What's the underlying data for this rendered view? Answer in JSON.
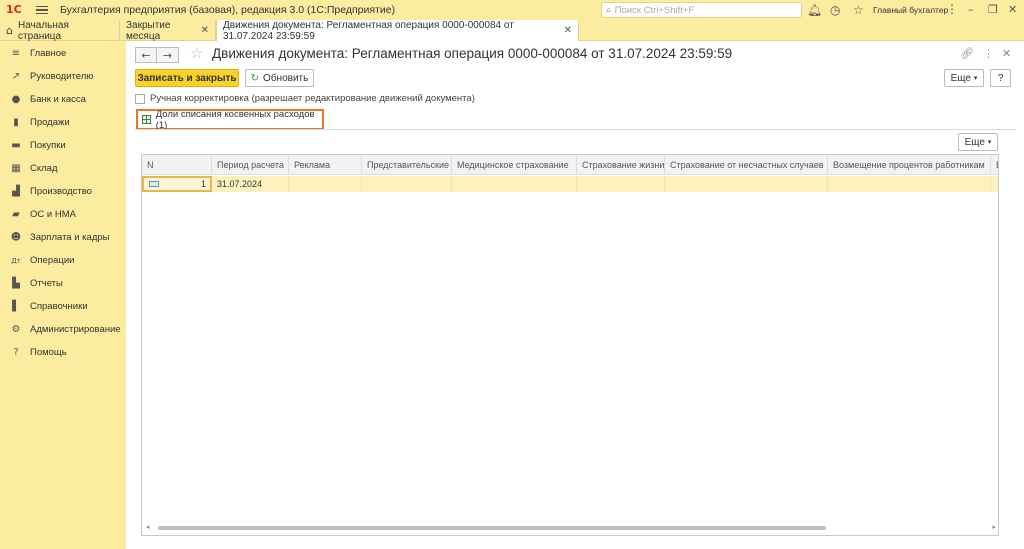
{
  "app": {
    "logo": "1С",
    "title": "Бухгалтерия предприятия (базовая), редакция 3.0  (1С:Предприятие)",
    "search_placeholder": "Поиск Ctrl+Shift+F",
    "user": "Главный бухгалтер",
    "icons": [
      "bell-icon",
      "history-icon",
      "star-icon"
    ]
  },
  "tabs": [
    {
      "label": "Начальная страница"
    },
    {
      "label": "Закрытие месяца"
    },
    {
      "label": "Движения документа: Регламентная операция 0000-000084 от 31.07.2024 23:59:59"
    }
  ],
  "sidebar": {
    "items": [
      {
        "label": "Главное",
        "icon": "menu-icon"
      },
      {
        "label": "Руководителю",
        "icon": "chart-line-icon"
      },
      {
        "label": "Банк и касса",
        "icon": "coins-icon"
      },
      {
        "label": "Продажи",
        "icon": "bag-icon"
      },
      {
        "label": "Покупки",
        "icon": "cart-icon"
      },
      {
        "label": "Склад",
        "icon": "boxes-icon"
      },
      {
        "label": "Производство",
        "icon": "factory-icon"
      },
      {
        "label": "ОС и НМА",
        "icon": "truck-icon"
      },
      {
        "label": "Зарплата и кадры",
        "icon": "person-icon"
      },
      {
        "label": "Операции",
        "icon": "operations-icon"
      },
      {
        "label": "Отчеты",
        "icon": "bar-chart-icon"
      },
      {
        "label": "Справочники",
        "icon": "book-icon"
      },
      {
        "label": "Администрирование",
        "icon": "gear-icon"
      },
      {
        "label": "Помощь",
        "icon": "question-icon"
      }
    ]
  },
  "document": {
    "title": "Движения документа: Регламентная операция 0000-000084 от 31.07.2024 23:59:59",
    "save_close": "Записать и закрыть",
    "refresh": "Обновить",
    "more": "Еще",
    "help": "?",
    "manual_correction": "Ручная корректировка (разрешает редактирование движений документа)",
    "manual_correction_checked": false,
    "table_tab": "Доли списания косвенных расходов (1)"
  },
  "grid": {
    "more": "Еще",
    "columns": [
      "N",
      "Период расчета",
      "Реклама",
      "Представительские",
      "Медицинское страхование",
      "Страхование жизни",
      "Страхование от несчастных случаев",
      "Возмещение процентов работникам",
      "В"
    ],
    "rows": [
      [
        "1",
        "31.07.2024",
        "",
        "",
        "",
        "",
        "",
        "",
        ""
      ]
    ]
  },
  "colors": {
    "accent": "#f9d12b",
    "highlight": "#e07a30",
    "sidebar_bg": "#fbeca0",
    "selected_row": "#fdf1be"
  }
}
